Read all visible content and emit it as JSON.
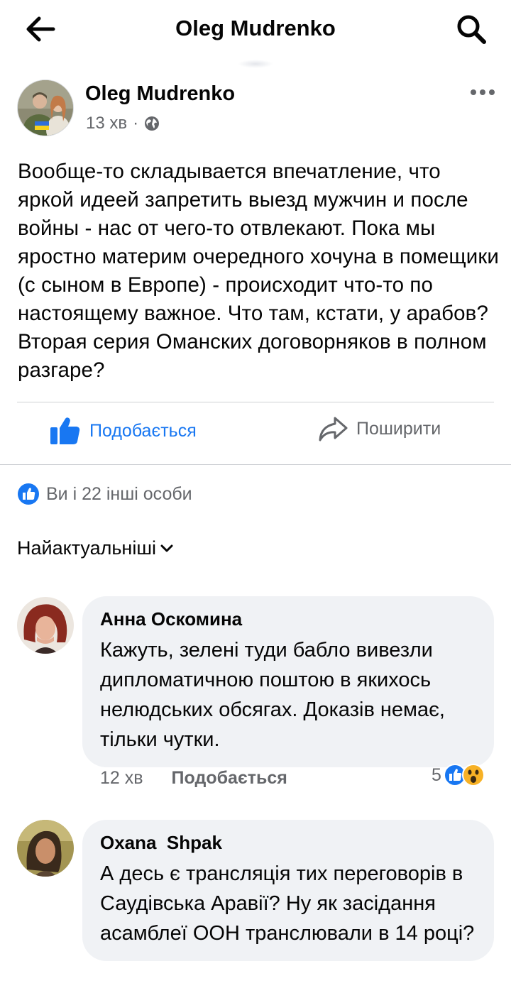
{
  "topbar": {
    "title": "Oleg Mudrenko",
    "back_icon": "arrow-left-icon",
    "search_icon": "search-icon"
  },
  "post": {
    "author": "Oleg Mudrenko",
    "time": "13 хв",
    "separator": "·",
    "privacy_icon": "globe-icon",
    "text": "Вообще-то складывается впечатление, что яркой идеей запретить выезд мужчин и после войны - нас от чего-то отвлекают. Пока мы яростно материм очередного хочуна в помещики (с сыном в Европе) - происходит что-то по настоящему важное. Что там, кстати, у арабов? Вторая серия Оманских договорняков в полном разгаре?"
  },
  "actions": {
    "like_label": "Подобається",
    "share_label": "Поширити"
  },
  "reactions": {
    "summary": "Ви і 22 інші особи"
  },
  "sort": {
    "label": "Найактуальніші"
  },
  "comments": [
    {
      "author": "Анна Оскомина",
      "text": "Кажуть, зелені туди бабло вивезли дипломатичною поштою в якихось нелюдських обсягах. Доказів немає, тільки чутки.",
      "time": "12 хв",
      "like_label": "Подобається",
      "reaction_count": "5"
    },
    {
      "author": "Oxana  Shpak",
      "text": "А десь є трансляція тих переговорів в Саудівська Аравії? Ну як засідання асамблеї ООН транслювали в 14 році?"
    }
  ],
  "colors": {
    "brand_blue": "#1877f2",
    "secondary_text": "#65676b",
    "bubble_bg": "#f0f2f5",
    "wow_yellow": "#f7b125"
  }
}
